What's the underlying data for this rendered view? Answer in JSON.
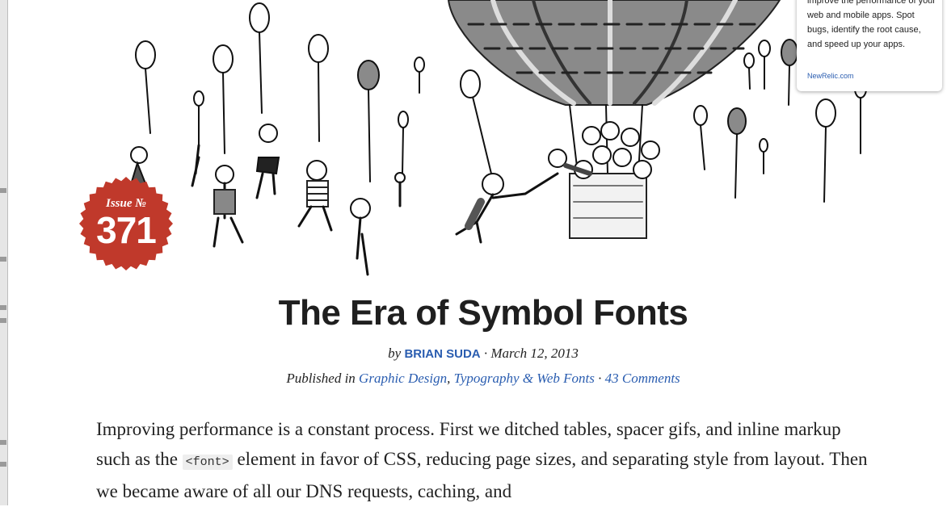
{
  "badge": {
    "issue_label": "Issue №",
    "number": "371",
    "color": "#c0392b"
  },
  "ad": {
    "text": "improve the performance of your web and mobile apps. Spot bugs, identify the root cause, and speed up your apps.",
    "link": "NewRelic.com"
  },
  "article": {
    "title": "The Era of Symbol Fonts",
    "by_prefix": "by",
    "author": "BRIAN SUDA",
    "date_sep": " · ",
    "date": "March 12, 2013",
    "published_prefix": "Published in",
    "categories": [
      "Graphic Design",
      "Typography & Web Fonts"
    ],
    "comma": ", ",
    "comments_sep": " · ",
    "comments": "43 Comments",
    "body": {
      "part1": "Improving performance is a constant process. First we ditched tables, spacer gifs, and inline markup such as the ",
      "code": "<font>",
      "part2": " element in favor of CSS, reducing page sizes, and separating style from layout. Then we became aware of all our DNS requests, caching, and"
    }
  },
  "colors": {
    "link": "#2a5db0",
    "title": "#1f1f1f"
  }
}
